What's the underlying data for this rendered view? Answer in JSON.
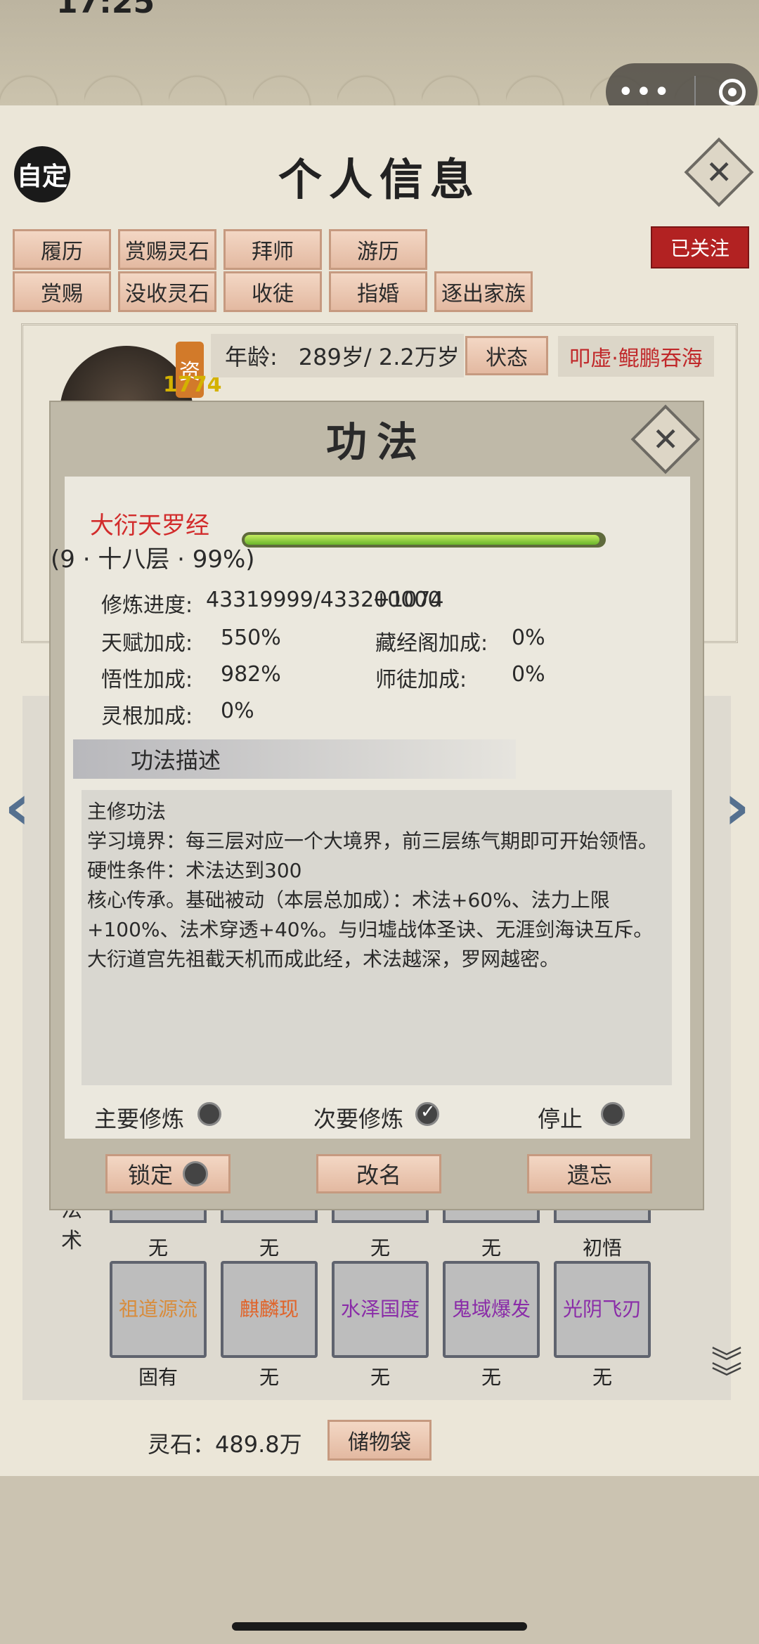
{
  "status_bar": {
    "time": "17:25"
  },
  "header": {
    "title": "个人信息",
    "auto_label": "自定"
  },
  "tags_row1": [
    "履历",
    "赏赐灵石",
    "拜师",
    "游历"
  ],
  "tags_row2": [
    "赏赐",
    "没收灵石",
    "收徒",
    "指婚",
    "逐出家族"
  ],
  "follow_label": "已关注",
  "profile": {
    "aptitude_label": "资",
    "aptitude_value": "1774",
    "age_label": "年龄:",
    "age_value": "289岁/ 2.2万岁",
    "status_label": "状态",
    "realm": "叩虚·鲲鹏吞海"
  },
  "modal": {
    "title": "功法",
    "skill_name": "大衍天罗经",
    "skill_level": "(9 · 十八层 · 99%)",
    "progress_ratio": 0.99,
    "progress_label": "修炼进度:",
    "progress_value": "43319999/433200000",
    "progress_overlap": "+1074",
    "stats": {
      "talent_label": "天赋加成:",
      "talent_value": "550%",
      "library_label": "藏经阁加成:",
      "library_value": "0%",
      "comprehension_label": "悟性加成:",
      "comprehension_value": "982%",
      "mentor_label": "师徒加成:",
      "mentor_value": "0%",
      "root_label": "灵根加成:",
      "root_value": "0%"
    },
    "desc_header": "功法描述",
    "desc_lines": [
      "主修功法",
      "学习境界：每三层对应一个大境界，前三层练气期即可开始领悟。",
      "硬性条件：术法达到300",
      "核心传承。基础被动（本层总加成）：术法+60%、法力上限+100%、法术穿透+40%。与归墟战体圣诀、无涯剑海诀互斥。大衍道宫先祖截天机而成此经，术法越深，罗网越密。"
    ],
    "radio_primary": "主要修炼",
    "radio_secondary": "次要修炼",
    "radio_stop": "停止",
    "btn_lock": "锁定",
    "btn_rename": "改名",
    "btn_forget": "遗忘"
  },
  "spells": {
    "side_label": "法术",
    "row1_caps": [
      "无",
      "无",
      "无",
      "无",
      "初悟"
    ],
    "row2": [
      {
        "name": "祖道源流",
        "color": "#d88c3c",
        "cap": "固有"
      },
      {
        "name": "麒麟现",
        "color": "#e0642a",
        "cap": "无"
      },
      {
        "name": "水泽国度",
        "color": "#8a2ca8",
        "cap": "无"
      },
      {
        "name": "鬼域爆发",
        "color": "#8a2ca8",
        "cap": "无"
      },
      {
        "name": "光阴飞刃",
        "color": "#8a2ca8",
        "cap": "无"
      }
    ]
  },
  "bottom": {
    "stone_label": "灵石：489.8万",
    "bag_label": "储物袋"
  }
}
